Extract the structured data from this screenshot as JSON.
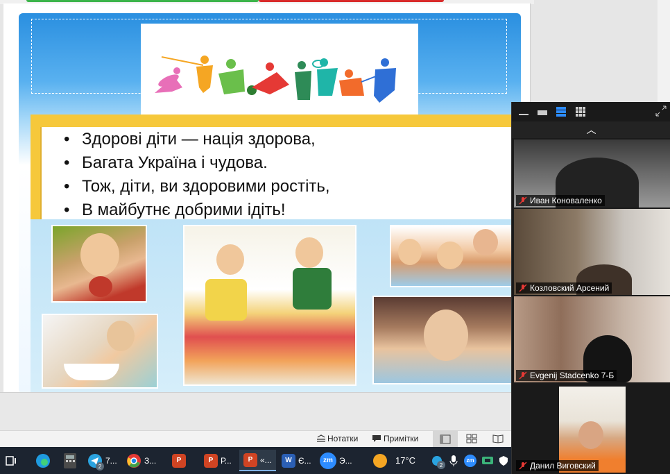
{
  "slide": {
    "poem": [
      "Здорові діти — нація здорова,",
      "Багата Україна і чудова.",
      "Тож, діти, ви здоровими ростіть,",
      "В майбутнє добрими ідіть!"
    ],
    "bullet": "•"
  },
  "statusbar": {
    "notes_label": "Нотатки",
    "comments_label": "Примітки"
  },
  "taskbar": {
    "telegram_label": "7...",
    "telegram_badge": "2",
    "chrome_label": "З...",
    "ppt2_label": "Р...",
    "ppt3_label": "«...",
    "word_label": "Є...",
    "zoom_label": "Э...",
    "zoom_icon_text": "zm",
    "weather_temp": "17°C",
    "tray_badge": "2"
  },
  "zoom": {
    "chevron": "︿",
    "participants": [
      {
        "name": "Иван Коноваленко"
      },
      {
        "name": "Козловский Арсений"
      },
      {
        "name": "Evgenij Stadcenko 7-Б"
      },
      {
        "name": "Данил Виговский"
      }
    ]
  },
  "colors": {
    "slide_blue": "#2a8fe0",
    "poem_frame": "#f6c83b",
    "taskbar_bg": "#1c2430",
    "mute_red": "#e53935"
  }
}
